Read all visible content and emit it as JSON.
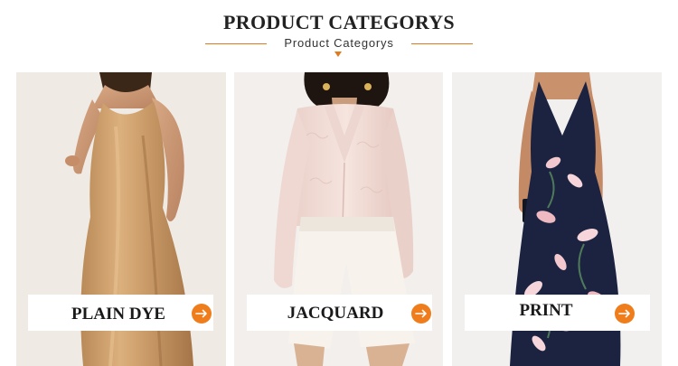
{
  "header": {
    "title": "PRODUCT CATEGORYS",
    "subtitle": "Product Categorys"
  },
  "categories": [
    {
      "label": "PLAIN DYE",
      "icon": "arrow-right-icon"
    },
    {
      "label": "JACQUARD",
      "icon": "arrow-right-icon"
    },
    {
      "label": "PRINT",
      "icon": "arrow-right-icon"
    }
  ],
  "colors": {
    "accent": "#ef7d1c",
    "title": "#222222"
  }
}
